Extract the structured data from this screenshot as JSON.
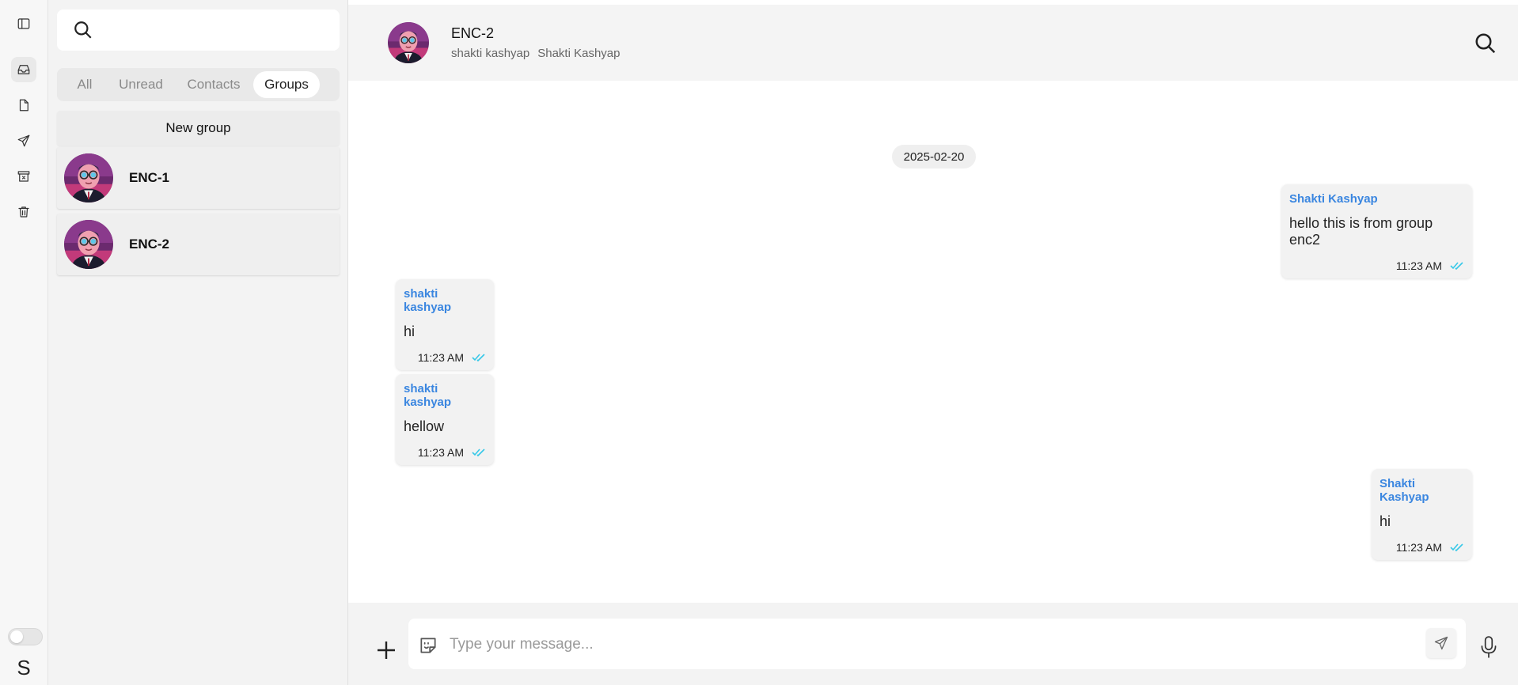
{
  "colors": {
    "accent_sender": "#3a86e0",
    "read_ticks": "#36c8e8",
    "bubble_bg": "#f2f2f2",
    "header_bg": "#f4f4f4"
  },
  "rail": {
    "items": [
      {
        "icon": "sidebar-toggle-icon"
      },
      {
        "icon": "inbox-icon",
        "active": true
      },
      {
        "icon": "file-icon"
      },
      {
        "icon": "send-icon"
      },
      {
        "icon": "archive-icon"
      },
      {
        "icon": "trash-icon"
      }
    ],
    "theme_toggle_on": false,
    "user_initial": "S"
  },
  "chat_list": {
    "search": {
      "value": "",
      "placeholder": ""
    },
    "tabs": [
      {
        "label": "All",
        "active": false
      },
      {
        "label": "Unread",
        "active": false
      },
      {
        "label": "Contacts",
        "active": false
      },
      {
        "label": "Groups",
        "active": true
      }
    ],
    "new_group_label": "New group",
    "chats": [
      {
        "name": "ENC-1"
      },
      {
        "name": "ENC-2"
      }
    ]
  },
  "chat": {
    "title": "ENC-2",
    "members": [
      "shakti kashyap",
      "Shakti Kashyap"
    ],
    "date": "2025-02-20",
    "messages": [
      {
        "sender": "Shakti Kashyap",
        "text": "hello this is from group enc2",
        "time": "11:23 AM",
        "outgoing": true
      },
      {
        "sender": "shakti kashyap",
        "text": "hi",
        "time": "11:23 AM",
        "outgoing": false
      },
      {
        "sender": "shakti kashyap",
        "text": "hellow",
        "time": "11:23 AM",
        "outgoing": false
      },
      {
        "sender": "Shakti Kashyap",
        "text": "hi",
        "time": "11:23 AM",
        "outgoing": true
      }
    ]
  },
  "composer": {
    "value": "",
    "placeholder": "Type your message..."
  }
}
